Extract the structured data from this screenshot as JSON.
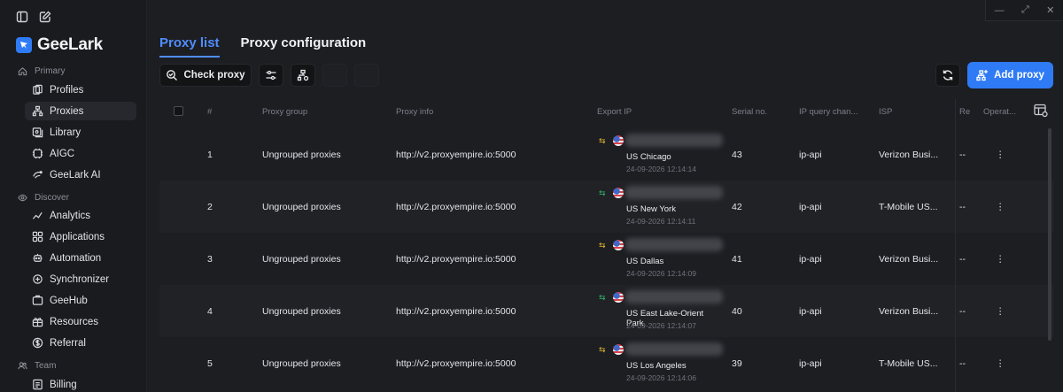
{
  "brand": {
    "name": "GeeLark",
    "color": "#2f7bf5"
  },
  "sidebar": {
    "sections": [
      {
        "label": "Primary",
        "icon": "home-icon"
      },
      {
        "label": "Discover",
        "icon": "eye-icon"
      },
      {
        "label": "Team",
        "icon": "team-icon"
      }
    ],
    "items": [
      {
        "label": "Profiles",
        "icon": "profiles-icon"
      },
      {
        "label": "Proxies",
        "icon": "proxies-icon",
        "active": true
      },
      {
        "label": "Library",
        "icon": "library-icon"
      },
      {
        "label": "AIGC",
        "icon": "aigc-icon"
      },
      {
        "label": "GeeLark AI",
        "icon": "ai-icon"
      },
      {
        "label": "Analytics",
        "icon": "analytics-icon"
      },
      {
        "label": "Applications",
        "icon": "applications-icon"
      },
      {
        "label": "Automation",
        "icon": "automation-icon"
      },
      {
        "label": "Synchronizer",
        "icon": "synchronizer-icon"
      },
      {
        "label": "GeeHub",
        "icon": "geehub-icon"
      },
      {
        "label": "Resources",
        "icon": "resources-icon"
      },
      {
        "label": "Referral",
        "icon": "referral-icon"
      },
      {
        "label": "Billing",
        "icon": "billing-icon"
      }
    ]
  },
  "tabs": [
    {
      "label": "Proxy list",
      "active": true
    },
    {
      "label": "Proxy configuration",
      "active": false
    }
  ],
  "toolbar": {
    "check_label": "Check proxy",
    "add_label": "Add proxy"
  },
  "table": {
    "headers": [
      "#",
      "Proxy group",
      "Proxy info",
      "Export IP",
      "Serial no.",
      "IP query chan...",
      "ISP",
      "Re",
      "Operat..."
    ],
    "rows": [
      {
        "index": "1",
        "group": "Ungrouped proxies",
        "info": "http://v2.proxyempire.io:5000",
        "city": "US Chicago",
        "time": "24-09-2026 12:14:14",
        "serial": "43",
        "channel": "ip-api",
        "isp": "Verizon Busi...",
        "re": "--",
        "arrow_color": "#e0b430"
      },
      {
        "index": "2",
        "group": "Ungrouped proxies",
        "info": "http://v2.proxyempire.io:5000",
        "city": "US New York",
        "time": "24-09-2026 12:14:11",
        "serial": "42",
        "channel": "ip-api",
        "isp": "T-Mobile US...",
        "re": "--",
        "arrow_color": "#33b36a"
      },
      {
        "index": "3",
        "group": "Ungrouped proxies",
        "info": "http://v2.proxyempire.io:5000",
        "city": "US Dallas",
        "time": "24-09-2026 12:14:09",
        "serial": "41",
        "channel": "ip-api",
        "isp": "Verizon Busi...",
        "re": "--",
        "arrow_color": "#e0b430"
      },
      {
        "index": "4",
        "group": "Ungrouped proxies",
        "info": "http://v2.proxyempire.io:5000",
        "city": "US East Lake-Orient Park",
        "time": "24-09-2026 12:14:07",
        "serial": "40",
        "channel": "ip-api",
        "isp": "Verizon Busi...",
        "re": "--",
        "arrow_color": "#33b36a"
      },
      {
        "index": "5",
        "group": "Ungrouped proxies",
        "info": "http://v2.proxyempire.io:5000",
        "city": "US Los Angeles",
        "time": "24-09-2026 12:14:06",
        "serial": "39",
        "channel": "ip-api",
        "isp": "T-Mobile US...",
        "re": "--",
        "arrow_color": "#e0b430"
      }
    ]
  }
}
